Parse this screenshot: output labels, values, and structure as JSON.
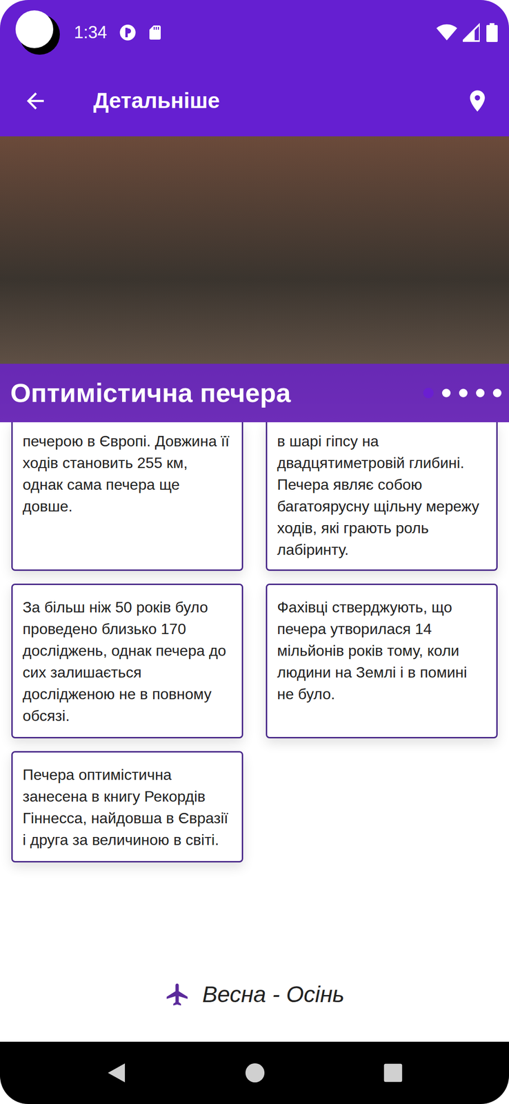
{
  "status_bar": {
    "time": "1:34"
  },
  "app_bar": {
    "title": "Детальніше"
  },
  "gallery": {
    "title": "Оптимістична печера",
    "indicators": [
      {
        "selected": true
      },
      {
        "selected": false
      },
      {
        "selected": false
      },
      {
        "selected": false
      },
      {
        "selected": false
      }
    ]
  },
  "facts": [
    {
      "kind": "clipped",
      "text": "печерою в Європі. Довжина її ходів становить 255 км, однак сама печера ще довше."
    },
    {
      "kind": "clipped",
      "text": "в шарі гіпсу на двадцятиметровій глибині. Печера являє собою багатоярусну щільну мережу ходів, які грають роль лабіринту."
    },
    {
      "kind": "full",
      "text": "За більш ніж 50 років було проведено близько 170 досліджень, однак печера до сих залишається дослідженою не в повному обсязі."
    },
    {
      "kind": "full",
      "text": "Фахівці стверджують, що печера утворилася 14 мільйонів років тому, коли людини на Землі і в помині не було."
    },
    {
      "kind": "full",
      "text": "Печера оптимістична занесена в книгу Рекордів Гіннесса, найдовша в Євразії і друга за величиною в світі."
    }
  ],
  "season": "Весна - Осінь"
}
